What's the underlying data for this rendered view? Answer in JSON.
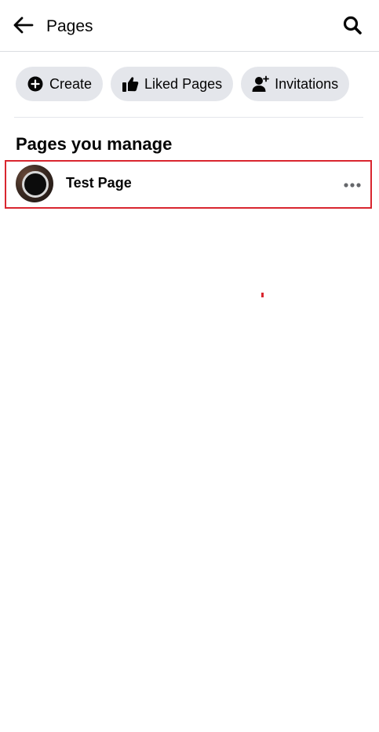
{
  "header": {
    "title": "Pages",
    "back_icon": "arrow-left-icon",
    "search_icon": "search-icon"
  },
  "chips": [
    {
      "label": "Create",
      "icon": "plus-circle-icon"
    },
    {
      "label": "Liked Pages",
      "icon": "thumbs-up-icon"
    },
    {
      "label": "Invitations",
      "icon": "person-add-icon"
    }
  ],
  "section": {
    "title": "Pages you manage"
  },
  "managed_pages": [
    {
      "name": "Test Page",
      "avatar": "page-avatar",
      "more_icon": "more-horizontal-icon"
    }
  ],
  "colors": {
    "chip_background": "#e4e6eb",
    "highlight_border": "#d9262f",
    "text": "#050505",
    "icon_gray": "#65676b"
  }
}
